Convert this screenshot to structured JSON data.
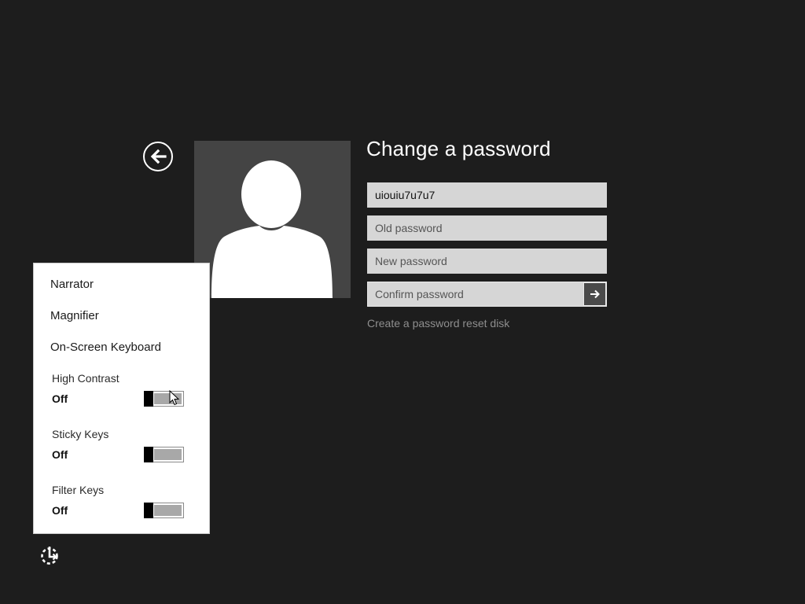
{
  "header": {
    "title": "Change a password"
  },
  "form": {
    "username_value": "uiouiu7u7u7",
    "old_password_placeholder": "Old password",
    "new_password_placeholder": "New password",
    "confirm_password_placeholder": "Confirm password",
    "reset_link": "Create a password reset disk"
  },
  "ease_of_access": {
    "items": [
      {
        "label": "Narrator"
      },
      {
        "label": "Magnifier"
      },
      {
        "label": "On-Screen Keyboard"
      }
    ],
    "toggles": [
      {
        "label": "High Contrast",
        "state": "Off"
      },
      {
        "label": "Sticky Keys",
        "state": "Off"
      },
      {
        "label": "Filter Keys",
        "state": "Off"
      }
    ]
  },
  "icons": {
    "back": "back-arrow-icon",
    "avatar": "user-silhouette-icon",
    "submit": "arrow-right-icon",
    "ease": "ease-of-access-icon"
  },
  "colors": {
    "background": "#1d1d1d",
    "field": "#d6d6d6",
    "avatar_bg": "#444444",
    "panel": "#ffffff",
    "link": "#8e8e8e"
  }
}
